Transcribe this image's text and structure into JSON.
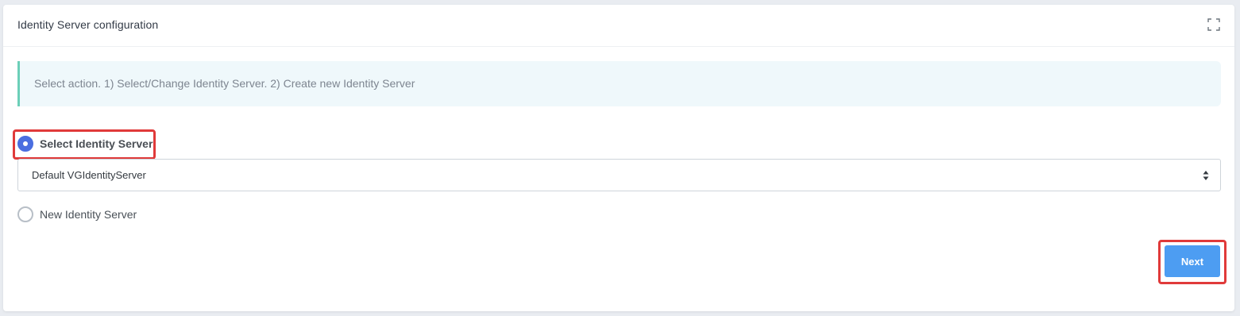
{
  "header": {
    "title": "Identity Server configuration",
    "expand_icon": "expand-icon"
  },
  "info": {
    "text": "Select action. 1) Select/Change Identity Server. 2) Create new Identity Server",
    "accent_color": "#6ccfb8",
    "background_color": "#eff8fb"
  },
  "options": [
    {
      "label": "Select Identity Server",
      "selected": true
    },
    {
      "label": "New Identity Server",
      "selected": false
    }
  ],
  "select": {
    "value": "Default VGIdentityServer"
  },
  "actions": {
    "next_label": "Next",
    "button_color": "#4d9df2"
  },
  "highlight_color": "#e03a3a"
}
